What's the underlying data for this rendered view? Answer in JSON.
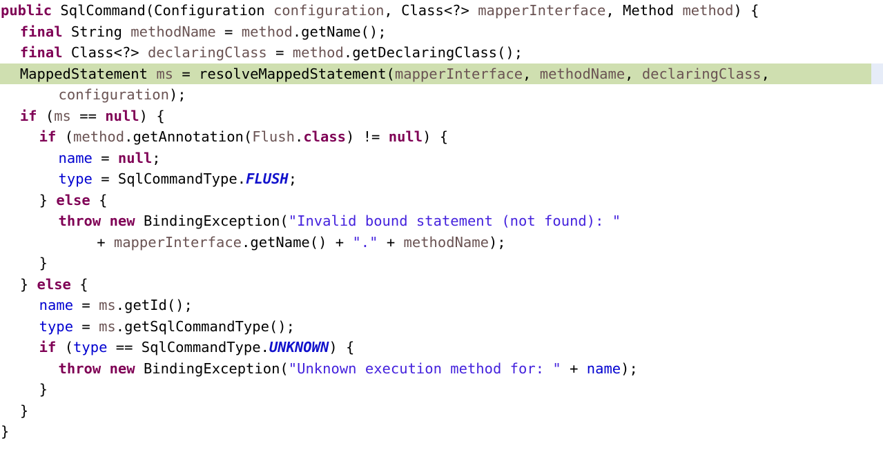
{
  "view": {
    "title": "SqlCommand constructor source",
    "language": "Java",
    "background_color": "#ffffff",
    "highlight_color": "#cfdfb0",
    "gutter_strip_color": "#e6ecf8",
    "colors": {
      "keyword": "#7f0055",
      "parameter": "#6a5353",
      "field": "#0000d0",
      "string": "#4422dd",
      "static_constant": "#1111cc",
      "plain": "#000000"
    },
    "highlighted_line_number": 4,
    "total_lines": 20
  },
  "lines": [
    {
      "n": 1,
      "indent": 0,
      "highlight": false,
      "tokens": [
        {
          "t": "public",
          "c": "keyword"
        },
        {
          "t": " ",
          "c": "plain"
        },
        {
          "t": "SqlCommand(",
          "c": "plain"
        },
        {
          "t": "Configuration",
          "c": "plain"
        },
        {
          "t": " ",
          "c": "plain"
        },
        {
          "t": "configuration",
          "c": "param"
        },
        {
          "t": ", ",
          "c": "plain"
        },
        {
          "t": "Class<?>",
          "c": "plain"
        },
        {
          "t": " ",
          "c": "plain"
        },
        {
          "t": "mapperInterface",
          "c": "param"
        },
        {
          "t": ", ",
          "c": "plain"
        },
        {
          "t": "Method",
          "c": "plain"
        },
        {
          "t": " ",
          "c": "plain"
        },
        {
          "t": "method",
          "c": "param"
        },
        {
          "t": ") {",
          "c": "plain"
        }
      ]
    },
    {
      "n": 2,
      "indent": 2,
      "highlight": false,
      "tokens": [
        {
          "t": "final",
          "c": "keyword"
        },
        {
          "t": " String ",
          "c": "plain"
        },
        {
          "t": "methodName",
          "c": "param"
        },
        {
          "t": " = ",
          "c": "plain"
        },
        {
          "t": "method",
          "c": "param"
        },
        {
          "t": ".getName();",
          "c": "plain"
        }
      ]
    },
    {
      "n": 3,
      "indent": 2,
      "highlight": false,
      "tokens": [
        {
          "t": "final",
          "c": "keyword"
        },
        {
          "t": " Class<?> ",
          "c": "plain"
        },
        {
          "t": "declaringClass",
          "c": "param"
        },
        {
          "t": " = ",
          "c": "plain"
        },
        {
          "t": "method",
          "c": "param"
        },
        {
          "t": ".getDeclaringClass();",
          "c": "plain"
        }
      ]
    },
    {
      "n": 4,
      "indent": 2,
      "highlight": true,
      "tokens": [
        {
          "t": "MappedStatement ",
          "c": "plain"
        },
        {
          "t": "ms",
          "c": "param"
        },
        {
          "t": " = resolveMappedStatement(",
          "c": "plain"
        },
        {
          "t": "mapperInterface",
          "c": "param"
        },
        {
          "t": ", ",
          "c": "plain"
        },
        {
          "t": "methodName",
          "c": "param"
        },
        {
          "t": ", ",
          "c": "plain"
        },
        {
          "t": "declaringClass",
          "c": "param"
        },
        {
          "t": ",",
          "c": "plain"
        }
      ]
    },
    {
      "n": 5,
      "indent": 6,
      "highlight": false,
      "tokens": [
        {
          "t": "configuration",
          "c": "param"
        },
        {
          "t": ");",
          "c": "plain"
        }
      ]
    },
    {
      "n": 6,
      "indent": 2,
      "highlight": false,
      "tokens": [
        {
          "t": "if",
          "c": "keyword"
        },
        {
          "t": " (",
          "c": "plain"
        },
        {
          "t": "ms",
          "c": "param"
        },
        {
          "t": " == ",
          "c": "plain"
        },
        {
          "t": "null",
          "c": "keyword"
        },
        {
          "t": ") {",
          "c": "plain"
        }
      ]
    },
    {
      "n": 7,
      "indent": 4,
      "highlight": false,
      "tokens": [
        {
          "t": "if",
          "c": "keyword"
        },
        {
          "t": " (",
          "c": "plain"
        },
        {
          "t": "method",
          "c": "param"
        },
        {
          "t": ".getAnnotation(",
          "c": "plain"
        },
        {
          "t": "Flush",
          "c": "param"
        },
        {
          "t": ".",
          "c": "plain"
        },
        {
          "t": "class",
          "c": "keyword"
        },
        {
          "t": ") != ",
          "c": "plain"
        },
        {
          "t": "null",
          "c": "keyword"
        },
        {
          "t": ") {",
          "c": "plain"
        }
      ]
    },
    {
      "n": 8,
      "indent": 6,
      "highlight": false,
      "tokens": [
        {
          "t": "name",
          "c": "field"
        },
        {
          "t": " = ",
          "c": "plain"
        },
        {
          "t": "null",
          "c": "keyword"
        },
        {
          "t": ";",
          "c": "plain"
        }
      ]
    },
    {
      "n": 9,
      "indent": 6,
      "highlight": false,
      "tokens": [
        {
          "t": "type",
          "c": "field"
        },
        {
          "t": " = SqlCommandType.",
          "c": "plain"
        },
        {
          "t": "FLUSH",
          "c": "static"
        },
        {
          "t": ";",
          "c": "plain"
        }
      ]
    },
    {
      "n": 10,
      "indent": 4,
      "highlight": false,
      "tokens": [
        {
          "t": "} ",
          "c": "plain"
        },
        {
          "t": "else",
          "c": "keyword"
        },
        {
          "t": " {",
          "c": "plain"
        }
      ]
    },
    {
      "n": 11,
      "indent": 6,
      "highlight": false,
      "tokens": [
        {
          "t": "throw",
          "c": "keyword"
        },
        {
          "t": " ",
          "c": "plain"
        },
        {
          "t": "new",
          "c": "keyword"
        },
        {
          "t": " BindingException(",
          "c": "plain"
        },
        {
          "t": "\"Invalid bound statement (not found): \"",
          "c": "string"
        }
      ]
    },
    {
      "n": 12,
      "indent": 10,
      "highlight": false,
      "tokens": [
        {
          "t": "+ ",
          "c": "plain"
        },
        {
          "t": "mapperInterface",
          "c": "param"
        },
        {
          "t": ".getName() + ",
          "c": "plain"
        },
        {
          "t": "\".\"",
          "c": "string"
        },
        {
          "t": " + ",
          "c": "plain"
        },
        {
          "t": "methodName",
          "c": "param"
        },
        {
          "t": ");",
          "c": "plain"
        }
      ]
    },
    {
      "n": 13,
      "indent": 4,
      "highlight": false,
      "tokens": [
        {
          "t": "}",
          "c": "plain"
        }
      ]
    },
    {
      "n": 14,
      "indent": 2,
      "highlight": false,
      "tokens": [
        {
          "t": "} ",
          "c": "plain"
        },
        {
          "t": "else",
          "c": "keyword"
        },
        {
          "t": " {",
          "c": "plain"
        }
      ]
    },
    {
      "n": 15,
      "indent": 4,
      "highlight": false,
      "tokens": [
        {
          "t": "name",
          "c": "field"
        },
        {
          "t": " = ",
          "c": "plain"
        },
        {
          "t": "ms",
          "c": "param"
        },
        {
          "t": ".getId();",
          "c": "plain"
        }
      ]
    },
    {
      "n": 16,
      "indent": 4,
      "highlight": false,
      "tokens": [
        {
          "t": "type",
          "c": "field"
        },
        {
          "t": " = ",
          "c": "plain"
        },
        {
          "t": "ms",
          "c": "param"
        },
        {
          "t": ".getSqlCommandType();",
          "c": "plain"
        }
      ]
    },
    {
      "n": 17,
      "indent": 4,
      "highlight": false,
      "tokens": [
        {
          "t": "if",
          "c": "keyword"
        },
        {
          "t": " (",
          "c": "plain"
        },
        {
          "t": "type",
          "c": "field"
        },
        {
          "t": " == SqlCommandType.",
          "c": "plain"
        },
        {
          "t": "UNKNOWN",
          "c": "static"
        },
        {
          "t": ") {",
          "c": "plain"
        }
      ]
    },
    {
      "n": 18,
      "indent": 6,
      "highlight": false,
      "tokens": [
        {
          "t": "throw",
          "c": "keyword"
        },
        {
          "t": " ",
          "c": "plain"
        },
        {
          "t": "new",
          "c": "keyword"
        },
        {
          "t": " BindingException(",
          "c": "plain"
        },
        {
          "t": "\"Unknown execution method for: \"",
          "c": "string"
        },
        {
          "t": " + ",
          "c": "plain"
        },
        {
          "t": "name",
          "c": "field"
        },
        {
          "t": ");",
          "c": "plain"
        }
      ]
    },
    {
      "n": 19,
      "indent": 4,
      "highlight": false,
      "tokens": [
        {
          "t": "}",
          "c": "plain"
        }
      ]
    },
    {
      "n": 20,
      "indent": 2,
      "highlight": false,
      "tokens": [
        {
          "t": "}",
          "c": "plain"
        }
      ]
    },
    {
      "n": 21,
      "indent": 0,
      "highlight": false,
      "tokens": [
        {
          "t": "}",
          "c": "plain"
        }
      ]
    }
  ]
}
